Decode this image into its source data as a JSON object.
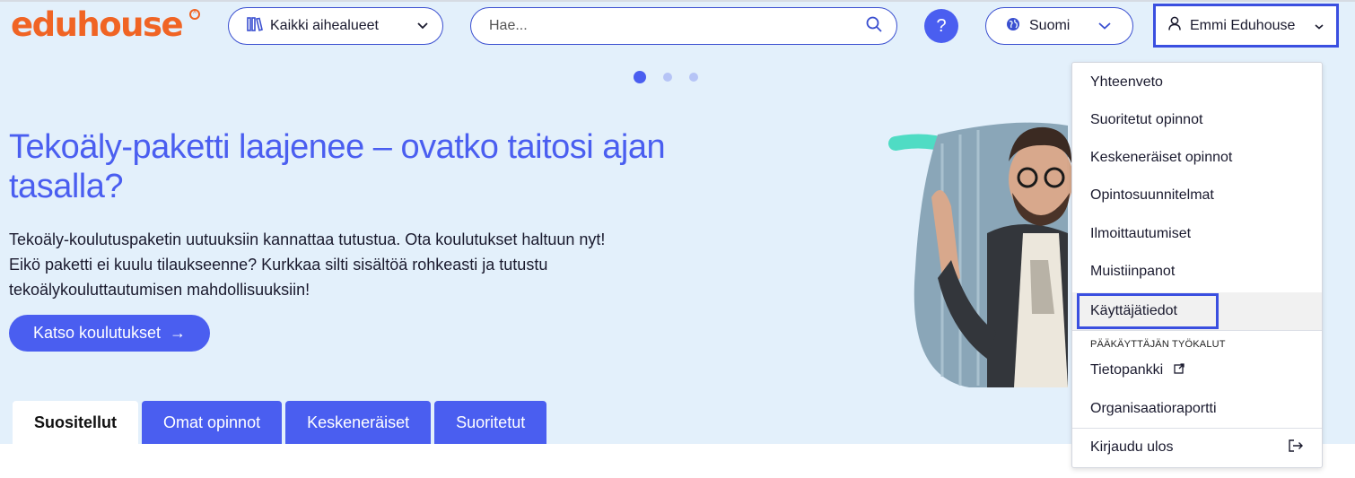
{
  "brand": {
    "logo": "eduhouse",
    "logo_color": "#f06424",
    "accent": "#4a5ef0"
  },
  "header": {
    "category_label": "Kaikki aihealueet",
    "search_placeholder": "Hae...",
    "help_label": "?",
    "language_label": "Suomi",
    "user_name": "Emmi Eduhouse"
  },
  "carousel": {
    "slide_count": 3,
    "active_slide": 1
  },
  "hero": {
    "title": "Tekoäly-paketti laajenee – ovatko taitosi ajan tasalla?",
    "description_lines": [
      "Tekoäly-koulutuspaketin uutuuksiin kannattaa tutustua. Ota koulutukset haltuun nyt!",
      "Eikö paketti ei kuulu tilaukseenne? Kurkkaa silti sisältöä rohkeasti ja tutustu",
      "tekoälykouluttautumisen mahdollisuuksiin!"
    ],
    "cta_label": "Katso koulutukset",
    "cta_arrow": "→"
  },
  "tabs": [
    {
      "label": "Suositellut",
      "active": true
    },
    {
      "label": "Omat opinnot",
      "active": false
    },
    {
      "label": "Keskeneräiset",
      "active": false
    },
    {
      "label": "Suoritetut",
      "active": false
    }
  ],
  "user_menu": {
    "items": [
      "Yhteenveto",
      "Suoritetut opinnot",
      "Keskeneräiset opinnot",
      "Opintosuunnitelmat",
      "Ilmoittautumiset",
      "Muistiinpanot",
      "Käyttäjätiedot"
    ],
    "highlighted_item": "Käyttäjätiedot",
    "admin_section_title": "PÄÄKÄYTTÄJÄN TYÖKALUT",
    "admin_items": [
      "Tietopankki",
      "Organisaatioraportti"
    ],
    "logout_label": "Kirjaudu ulos"
  },
  "icons": {
    "category": "books-icon",
    "category_chevron": "chevron-down-icon",
    "search": "search-icon",
    "language": "globe-icon",
    "language_chevron": "chevron-down-icon",
    "user": "user-icon",
    "user_chevron": "chevron-down-icon",
    "external": "external-link-icon",
    "logout": "logout-icon"
  }
}
